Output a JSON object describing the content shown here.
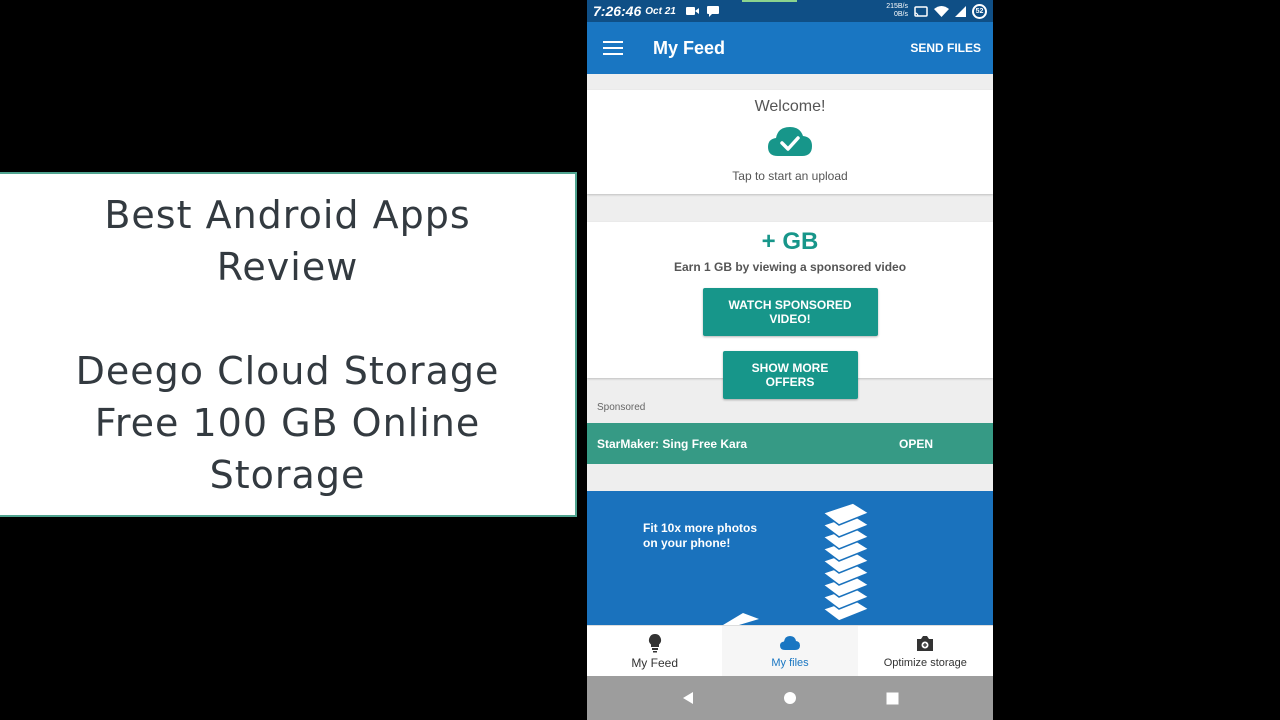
{
  "title_card": {
    "line1": "Best Android Apps",
    "line2": "Review",
    "line3": "Deego Cloud Storage",
    "line4": "Free 100 GB Online",
    "line5": "Storage"
  },
  "status_bar": {
    "time": "7:26:46",
    "date": "Oct 21",
    "speed_up": "215B/s",
    "speed_down": "0B/s",
    "battery": "52"
  },
  "app_bar": {
    "title": "My Feed",
    "send_files": "SEND FILES"
  },
  "welcome_card": {
    "title": "Welcome!",
    "subtitle": "Tap to start an upload"
  },
  "gb_card": {
    "title": "+ GB",
    "earn_text": "Earn 1 GB by viewing a sponsored video",
    "watch_button": "WATCH SPONSORED VIDEO!",
    "offers_button": "SHOW MORE OFFERS"
  },
  "sponsored": {
    "label": "Sponsored",
    "ad_title": "StarMaker: Sing Free Kara",
    "ad_action": "OPEN"
  },
  "promo": {
    "text": "Fit 10x more photos\non your phone!"
  },
  "bottom_nav": {
    "items": [
      {
        "label": "My Feed",
        "icon": "lightbulb-icon"
      },
      {
        "label": "My files",
        "icon": "cloud-icon"
      },
      {
        "label": "Optimize storage",
        "icon": "camera-icon"
      }
    ],
    "active": "My files"
  },
  "colors": {
    "app_bar": "#1976c2",
    "status_bar": "#0f4f86",
    "teal": "#17968a",
    "ad_bar": "#369a85",
    "promo": "#1a72bd"
  }
}
